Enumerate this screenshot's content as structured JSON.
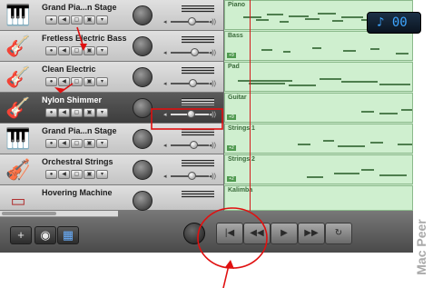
{
  "tracks": [
    {
      "name": "Grand Pia...n Stage",
      "icon": "piano-icon",
      "icon_glyph": "🎹",
      "volume": 0.55
    },
    {
      "name": "Fretless Electric Bass",
      "icon": "bass-guitar-icon",
      "icon_glyph": "🎸",
      "volume": 0.62
    },
    {
      "name": "Clean Electric",
      "icon": "electric-guitar-icon",
      "icon_glyph": "🎸",
      "volume": 0.58
    },
    {
      "name": "Nylon Shimmer",
      "icon": "acoustic-guitar-icon",
      "icon_glyph": "🎸",
      "volume": 0.52
    },
    {
      "name": "Grand Pia...n Stage",
      "icon": "piano-icon",
      "icon_glyph": "🎹",
      "volume": 0.6
    },
    {
      "name": "Orchestral Strings",
      "icon": "violin-icon",
      "icon_glyph": "🎻",
      "volume": 0.55
    },
    {
      "name": "Hovering Machine",
      "icon": "synth-keyboard-icon",
      "icon_glyph": "▭",
      "volume": 0.5
    }
  ],
  "regions": [
    "Piano",
    "Bass",
    "Pad",
    "Guitar",
    "Strings 1",
    "Strings 2",
    "Kalimba"
  ],
  "track_buttons": [
    "●",
    "◀",
    "▢",
    "▣",
    "▾"
  ],
  "toolbar": {
    "add_track": "+",
    "editor": "◉",
    "loop_browser": "▦",
    "lcd_display": "♪ 00"
  },
  "transport": {
    "go_to_beginning": "|◀",
    "rewind": "◀◀",
    "play": "▶",
    "fast_forward": "▶▶",
    "cycle": "↻"
  },
  "watermark": "Mac Peer",
  "colors": {
    "annotation": "#e01010",
    "region": "#c9e9c9",
    "lcd_text": "#3fa6ff"
  }
}
